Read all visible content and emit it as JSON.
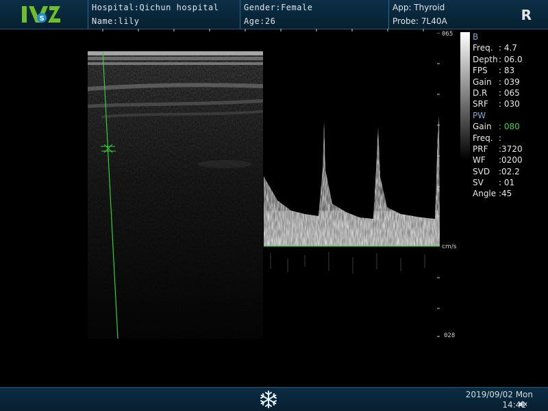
{
  "header": {
    "hospital": "Hospital:Qichun hospital",
    "name": "Name:lily",
    "gender": "Gender:Female",
    "age": "Age:26",
    "app": "App: Thyroid",
    "probe": "Probe: 7L40A",
    "orientation_marker": "R"
  },
  "doppler_scale": {
    "top_label": "065",
    "bottom_label": "028",
    "unit": "cm/s"
  },
  "params": {
    "b_title": "B",
    "b_rows": [
      {
        "k": "Freq.",
        "v": ": 4.7"
      },
      {
        "k": "Depth",
        "v": ": 06.0"
      },
      {
        "k": "FPS",
        "v": ": 83"
      },
      {
        "k": "Gain",
        "v": ": 039"
      },
      {
        "k": "D.R",
        "v": ": 065"
      },
      {
        "k": "SRF",
        "v": ": 030"
      }
    ],
    "pw_title": "PW",
    "pw_rows": [
      {
        "k": "Gain",
        "v": ": 080"
      },
      {
        "k": "Freq.",
        "v": ":"
      },
      {
        "k": "PRF",
        "v": ":3720"
      },
      {
        "k": "WF",
        "v": ":0200"
      },
      {
        "k": "SVD",
        "v": ":02.2"
      },
      {
        "k": "SV",
        "v": ": 01"
      },
      {
        "k": "Angle",
        "v": ":45"
      }
    ]
  },
  "footer": {
    "date": "2019/09/02 Mon",
    "time": "14:41"
  },
  "colors": {
    "cursor_line": "#35d035",
    "gain_highlight": "#3cd23c",
    "section_title": "#7fa8d8",
    "bar_bg": "#06202f"
  },
  "icons": {
    "logo": "brand-logo",
    "freeze": "snowflake-icon",
    "mute": "speaker-mute-icon"
  }
}
